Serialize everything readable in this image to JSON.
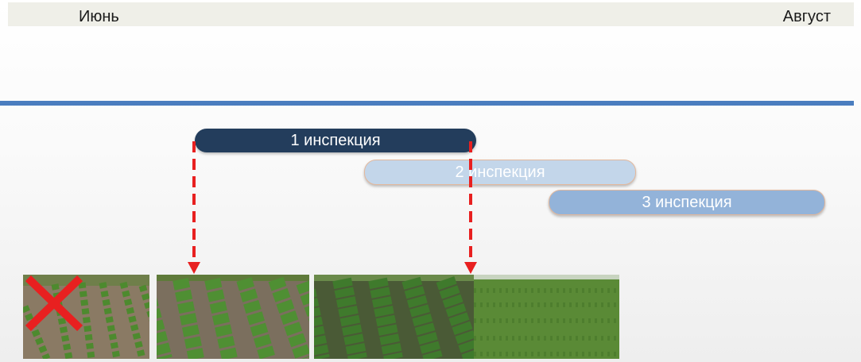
{
  "timeline": {
    "start_label": "Июнь",
    "end_label": "Август"
  },
  "inspections": [
    {
      "label": "1 инспекция",
      "color": "#233d5c"
    },
    {
      "label": "2 инспекция",
      "color": "#c3d6ea"
    },
    {
      "label": "3 инспекция",
      "color": "#93b3d9"
    }
  ],
  "colors": {
    "timeline_line": "#4a7dbf",
    "arrow": "#e82020",
    "cross": "#e82020",
    "soil": "#8a7a64",
    "foliage": "#4d8a2e"
  },
  "photos": [
    {
      "icon": "young-potato-field-photo",
      "crossed": true
    },
    {
      "icon": "potato-rows-photo",
      "crossed": false
    },
    {
      "icon": "dense-potato-rows-photo",
      "crossed": false
    },
    {
      "icon": "closed-canopy-field-photo",
      "crossed": false
    }
  ]
}
